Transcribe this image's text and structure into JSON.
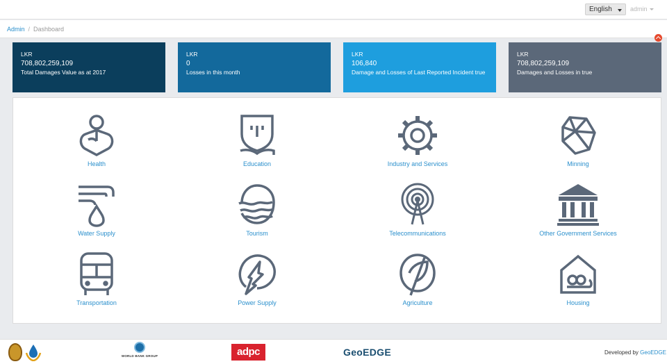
{
  "header": {
    "language": "English",
    "user": "admin"
  },
  "breadcrumb": {
    "root": "Admin",
    "separator": "/",
    "current": "Dashboard"
  },
  "cards": [
    {
      "currency": "LKR",
      "value": "708,802,259,109",
      "desc": "Total Damages Value as at 2017",
      "color": "#0b3e5c"
    },
    {
      "currency": "LKR",
      "value": "0",
      "desc": "Losses in this month",
      "color": "#13699c"
    },
    {
      "currency": "LKR",
      "value": "106,840",
      "desc": "Damage and Losses of Last Reported Incident true",
      "color": "#1e9ede"
    },
    {
      "currency": "LKR",
      "value": "708,802,259,109",
      "desc": "Damages and Losses in true",
      "color": "#5b6879"
    }
  ],
  "sectors": [
    {
      "label": "Health",
      "icon": "health-icon"
    },
    {
      "label": "Education",
      "icon": "education-icon"
    },
    {
      "label": "Industry and Services",
      "icon": "industry-gear-icon"
    },
    {
      "label": "Minning",
      "icon": "mining-gem-icon"
    },
    {
      "label": "Water Supply",
      "icon": "water-tap-icon"
    },
    {
      "label": "Tourism",
      "icon": "tourism-sun-waves-icon"
    },
    {
      "label": "Telecommunications",
      "icon": "telecom-tower-icon"
    },
    {
      "label": "Other Government Services",
      "icon": "government-building-icon"
    },
    {
      "label": "Transportation",
      "icon": "bus-icon"
    },
    {
      "label": "Power Supply",
      "icon": "lightning-icon"
    },
    {
      "label": "Agriculture",
      "icon": "leaf-icon"
    },
    {
      "label": "Housing",
      "icon": "house-icon"
    }
  ],
  "footer": {
    "world_bank": "WORLD BANK GROUP",
    "adpc": "adpc",
    "geoedge": "GeoEDGE",
    "developed_by": "Developed by",
    "developer": "GeoEDGE"
  },
  "colors": {
    "icon": "#5b6879",
    "link": "#2a8fcc",
    "accent_red": "#e64a2e"
  }
}
